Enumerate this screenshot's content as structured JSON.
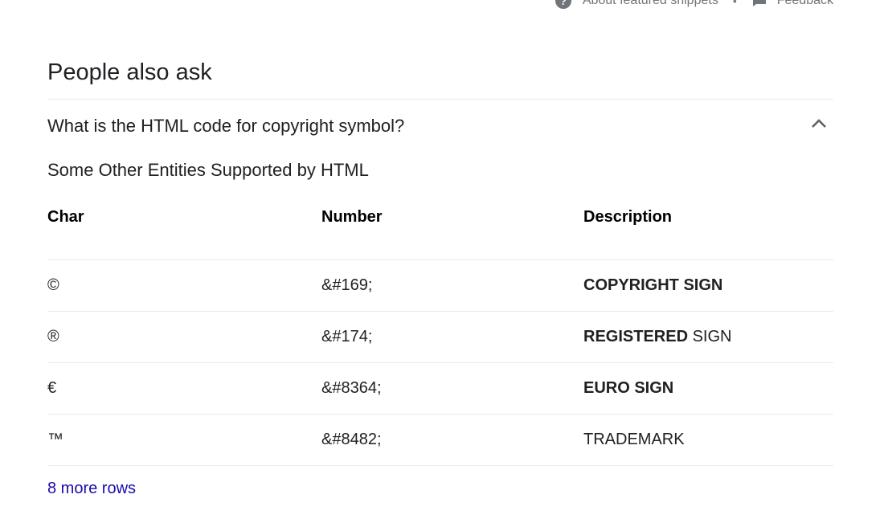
{
  "top_strip": {
    "about_label": "About featured snippets",
    "separator": "•",
    "feedback_label": "Feedback",
    "info_icon": "info-icon",
    "feedback_icon": "feedback-icon"
  },
  "paa": {
    "heading": "People also ask",
    "question": "What is the HTML code for copyright symbol?",
    "chevron_icon": "chevron-up-icon",
    "answer_title": "Some Other Entities Supported by HTML",
    "table": {
      "headers": [
        "Char",
        "Number",
        "Description"
      ],
      "rows": [
        {
          "char": "©",
          "number": "&#169;",
          "desc_bold": "COPYRIGHT SIGN",
          "desc_rest": ""
        },
        {
          "char": "®",
          "number": "&#174;",
          "desc_bold": "REGISTERED",
          "desc_rest": " SIGN"
        },
        {
          "char": "€",
          "number": "&#8364;",
          "desc_bold": "EURO SIGN",
          "desc_rest": ""
        },
        {
          "char": "™",
          "number": "&#8482;",
          "desc_bold": "",
          "desc_rest": "TRADEMARK"
        }
      ]
    },
    "more_rows_label": "8 more rows"
  },
  "colors": {
    "link": "#1a0dab",
    "text": "#202124",
    "muted": "#70757a",
    "divider": "#e8eaed"
  }
}
